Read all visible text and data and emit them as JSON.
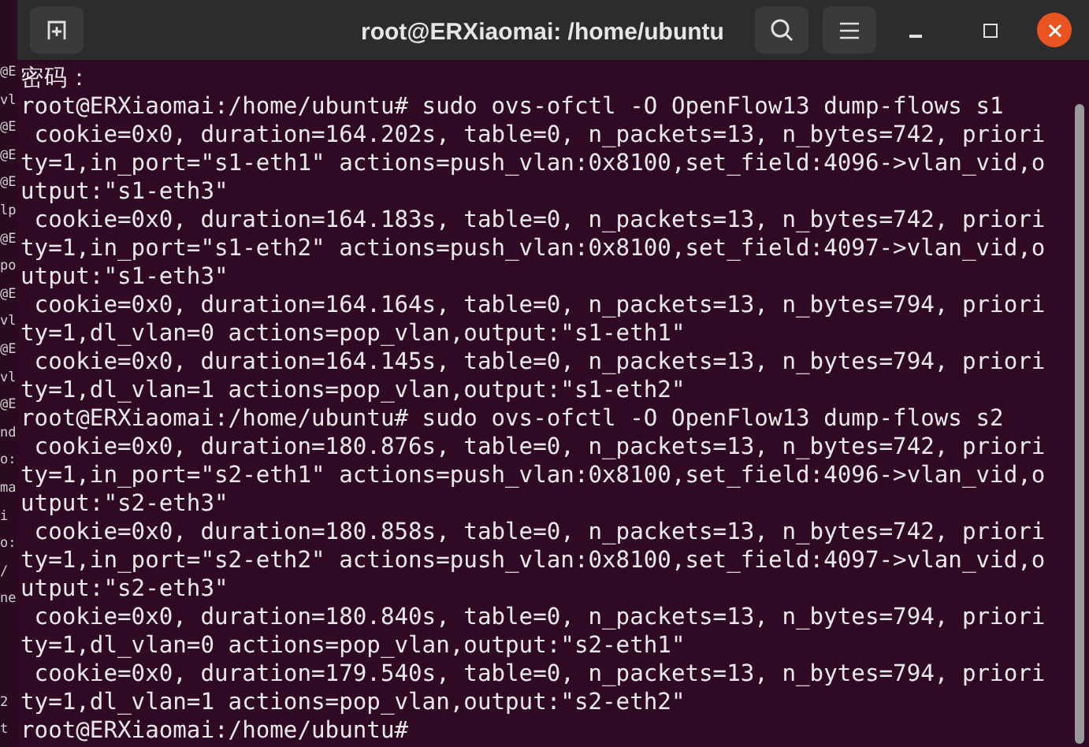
{
  "background_window": {
    "lines": [
      "@E",
      "vl",
      "@E",
      "@E",
      "@E",
      "lp",
      "@E",
      "po",
      "@E",
      "vl",
      "@E",
      "vl",
      "@E",
      "nd",
      "o:",
      "ma",
      "i",
      "o:",
      "/",
      "ne"
    ],
    "bottom_lines": [
      "2",
      "t"
    ]
  },
  "window": {
    "title": "root@ERXiaomai: /home/ubuntu"
  },
  "terminal": {
    "lines": [
      "密码：",
      "root@ERXiaomai:/home/ubuntu# sudo ovs-ofctl -O OpenFlow13 dump-flows s1",
      " cookie=0x0, duration=164.202s, table=0, n_packets=13, n_bytes=742, priori",
      "ty=1,in_port=\"s1-eth1\" actions=push_vlan:0x8100,set_field:4096->vlan_vid,o",
      "utput:\"s1-eth3\"",
      " cookie=0x0, duration=164.183s, table=0, n_packets=13, n_bytes=742, priori",
      "ty=1,in_port=\"s1-eth2\" actions=push_vlan:0x8100,set_field:4097->vlan_vid,o",
      "utput:\"s1-eth3\"",
      " cookie=0x0, duration=164.164s, table=0, n_packets=13, n_bytes=794, priori",
      "ty=1,dl_vlan=0 actions=pop_vlan,output:\"s1-eth1\"",
      " cookie=0x0, duration=164.145s, table=0, n_packets=13, n_bytes=794, priori",
      "ty=1,dl_vlan=1 actions=pop_vlan,output:\"s1-eth2\"",
      "root@ERXiaomai:/home/ubuntu# sudo ovs-ofctl -O OpenFlow13 dump-flows s2",
      " cookie=0x0, duration=180.876s, table=0, n_packets=13, n_bytes=742, priori",
      "ty=1,in_port=\"s2-eth1\" actions=push_vlan:0x8100,set_field:4096->vlan_vid,o",
      "utput:\"s2-eth3\"",
      " cookie=0x0, duration=180.858s, table=0, n_packets=13, n_bytes=742, priori",
      "ty=1,in_port=\"s2-eth2\" actions=push_vlan:0x8100,set_field:4097->vlan_vid,o",
      "utput:\"s2-eth3\"",
      " cookie=0x0, duration=180.840s, table=0, n_packets=13, n_bytes=794, priori",
      "ty=1,dl_vlan=0 actions=pop_vlan,output:\"s2-eth1\"",
      " cookie=0x0, duration=179.540s, table=0, n_packets=13, n_bytes=794, priori",
      "ty=1,dl_vlan=1 actions=pop_vlan,output:\"s2-eth2\"",
      "root@ERXiaomai:/home/ubuntu# "
    ]
  }
}
